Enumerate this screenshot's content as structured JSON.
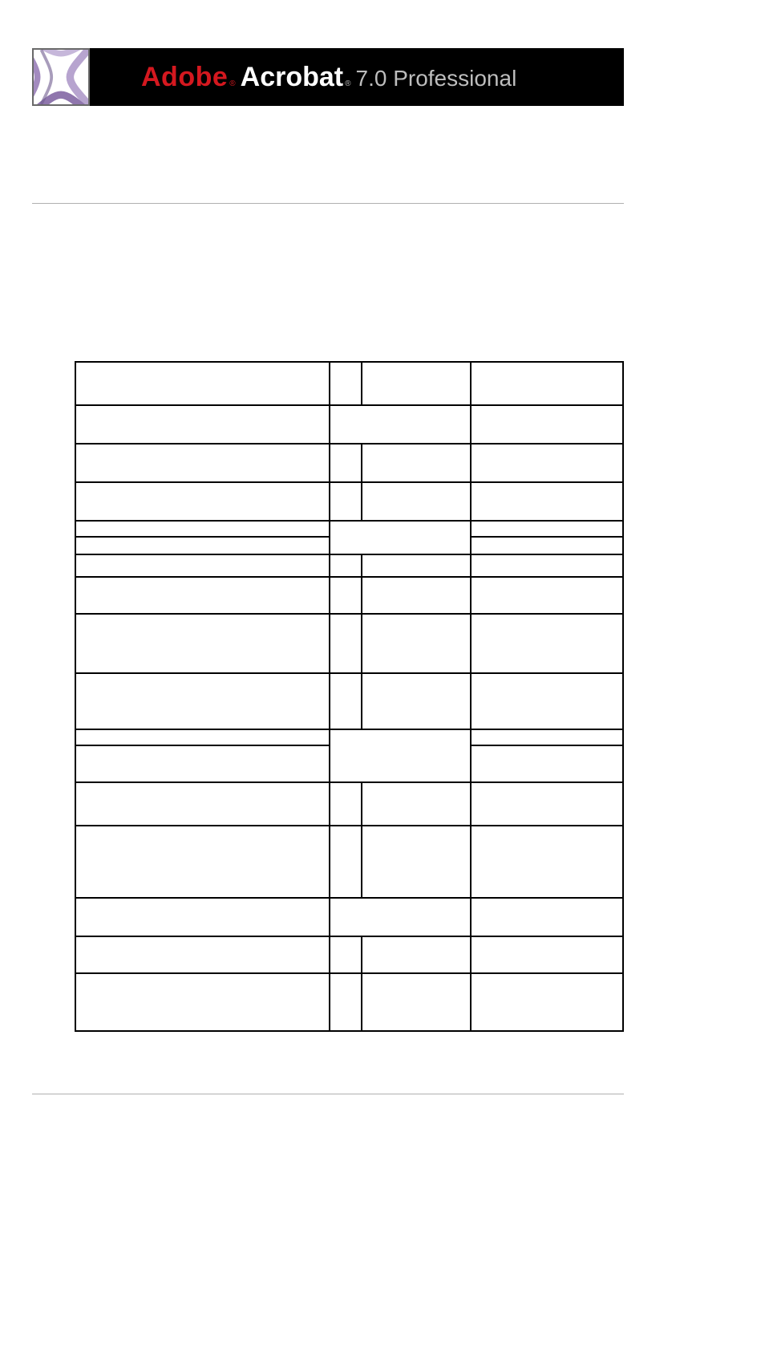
{
  "banner": {
    "brand": "Adobe",
    "brand_reg": "®",
    "product": "Acrobat",
    "product_reg": "®",
    "version": "7.0 Professional"
  },
  "icon": {
    "name": "acrobat-curves-icon"
  }
}
